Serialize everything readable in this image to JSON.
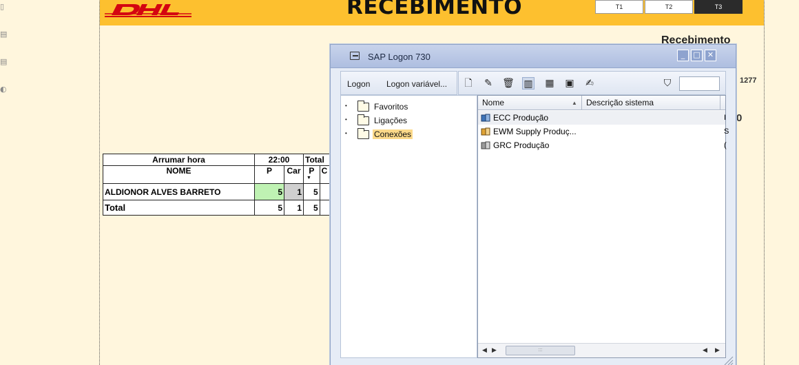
{
  "report": {
    "title": "RECEBIMENTO",
    "subtitle": "Recebimento",
    "side_value": "1277",
    "side_value_2": "0",
    "shifts": [
      "T1",
      "T2",
      "T3"
    ],
    "active_shift": "T3",
    "brand_color": "#fdc02f",
    "brand_red": "#d40511",
    "table": {
      "header_row1": {
        "arrumar_hora": "Arrumar hora",
        "hora": "22:00",
        "total": "Total"
      },
      "header_row2": {
        "nome": "NOME",
        "p": "P",
        "car": "Car",
        "p2": "P",
        "c2": "C"
      },
      "rows": [
        {
          "nome": "ALDIONOR ALVES BARRETO",
          "p": "5",
          "car": "1",
          "total_p": "5"
        }
      ],
      "total_row": {
        "label": "Total",
        "p": "5",
        "car": "1",
        "total_p": "5"
      }
    }
  },
  "sap_logon": {
    "window_title": "SAP Logon 730",
    "window_buttons": {
      "minimize": "minimize-icon",
      "maximize": "maximize-icon",
      "close": "close-icon"
    },
    "toolbar": {
      "logon_label": "Logon",
      "logon_variable_label": "Logon variável...",
      "icons": [
        "new-entry-icon",
        "edit-icon",
        "delete-icon",
        "list-view-icon",
        "grid-view-icon",
        "tree-view-icon",
        "properties-icon",
        "filter-icon"
      ]
    },
    "filter_value": "",
    "tree": [
      {
        "label": "Favoritos",
        "icon": "folder-icon",
        "active": false
      },
      {
        "label": "Ligações",
        "icon": "folder-icon",
        "active": false
      },
      {
        "label": "Conexões",
        "icon": "folder-icon",
        "active": true
      }
    ],
    "list": {
      "columns": [
        "Nome",
        "Descrição sistema"
      ],
      "sorted_column": "Nome",
      "rows": [
        {
          "name": "ECC Produção",
          "cut": "I"
        },
        {
          "name": "EWM Supply Produç...",
          "cut": "S"
        },
        {
          "name": "GRC Produção",
          "cut": "("
        }
      ]
    }
  }
}
